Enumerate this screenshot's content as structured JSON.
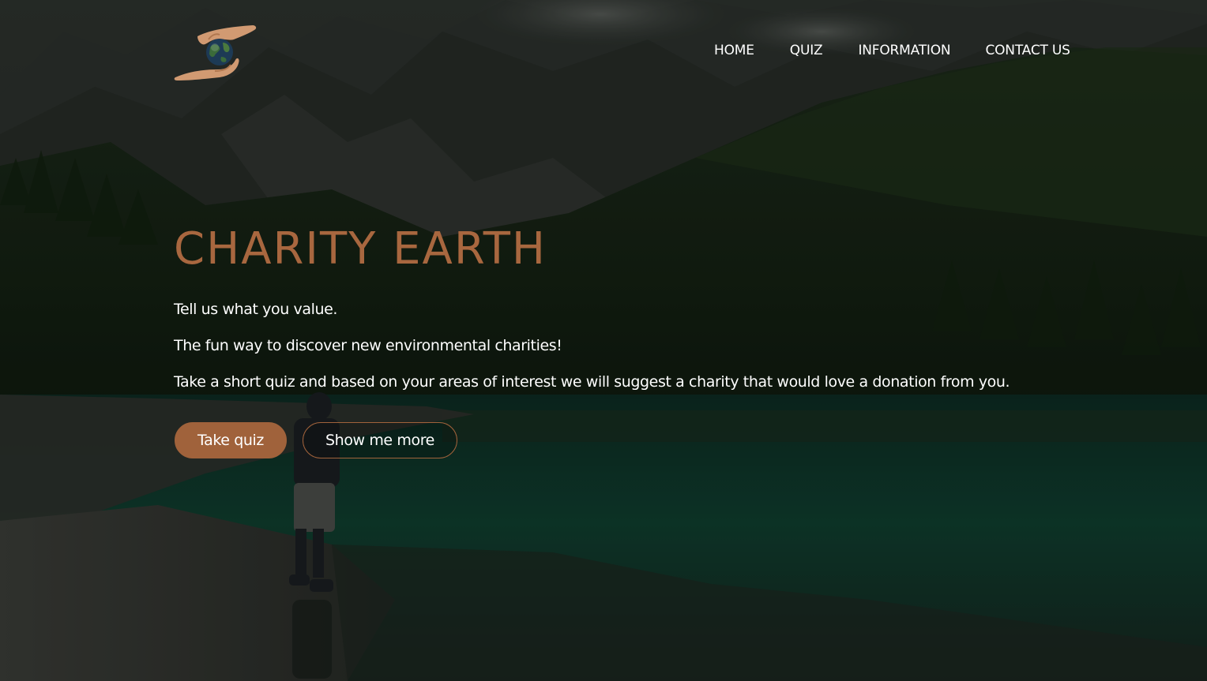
{
  "logo": {
    "icon": "hands-holding-earth-icon"
  },
  "nav": {
    "items": [
      {
        "label": "HOME"
      },
      {
        "label": "QUIZ"
      },
      {
        "label": "INFORMATION"
      },
      {
        "label": "CONTACT US"
      }
    ]
  },
  "hero": {
    "title": "CHARITY EARTH",
    "paragraphs": [
      "Tell us what you value.",
      "The fun way to discover new environmental charities!",
      "Take a short quiz and based on your areas of interest we will suggest a charity that would love a donation from you."
    ],
    "buttons": {
      "primary_label": "Take quiz",
      "secondary_label": "Show me more"
    }
  },
  "colors": {
    "accent": "#a8673f",
    "button_fill": "#a0623b",
    "text": "#ffffff",
    "background_dark": "#10170f"
  }
}
